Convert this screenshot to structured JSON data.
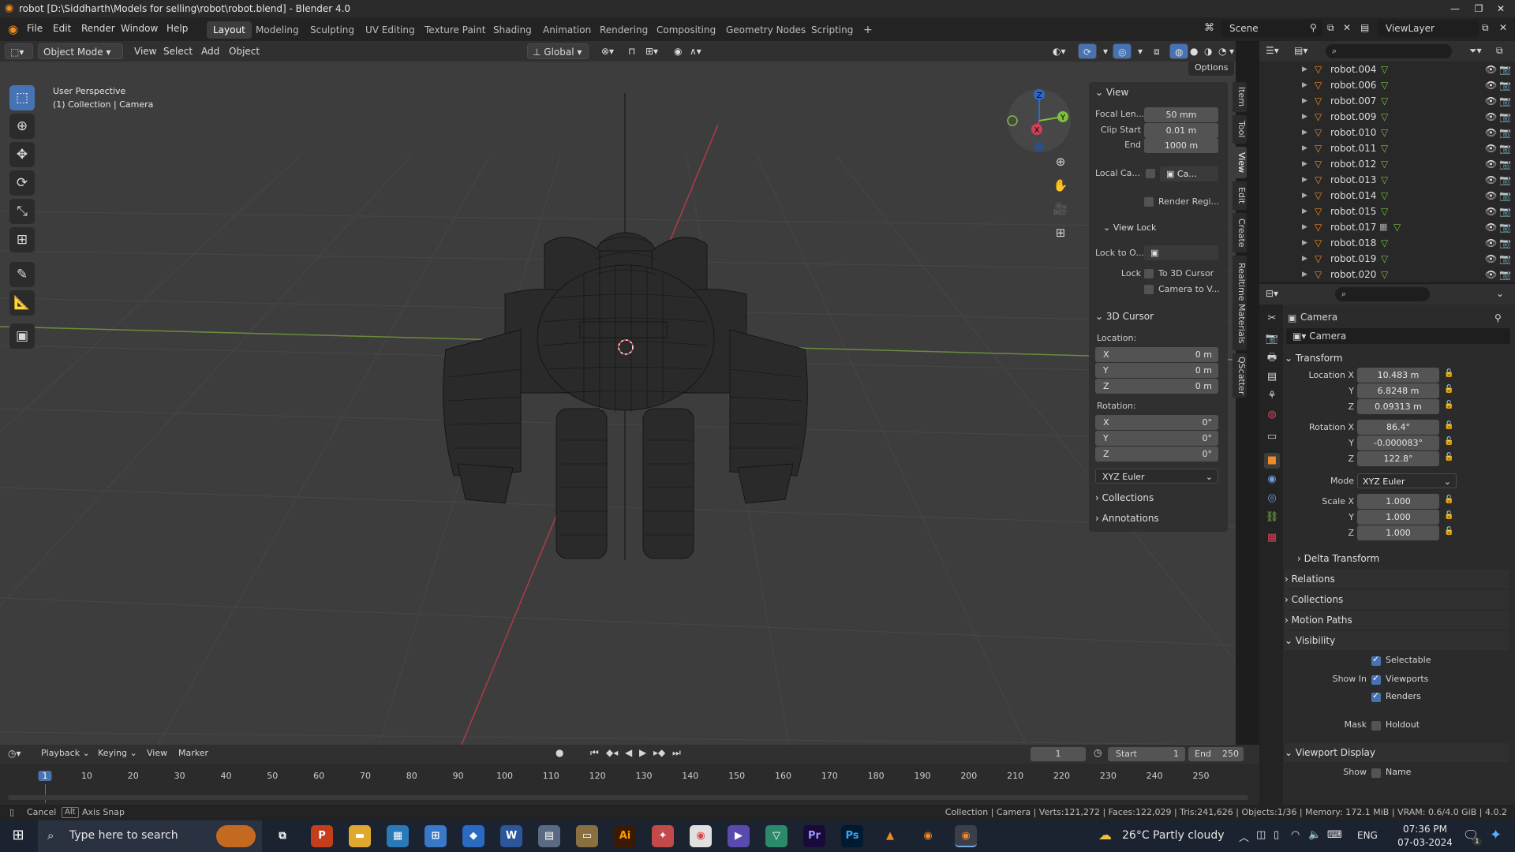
{
  "title_bar": {
    "app_title": "robot [D:\\Siddharth\\Models for selling\\robot\\robot.blend] - Blender 4.0"
  },
  "menu": [
    "File",
    "Edit",
    "Render",
    "Window",
    "Help"
  ],
  "workspaces": [
    "Layout",
    "Modeling",
    "Sculpting",
    "UV Editing",
    "Texture Paint",
    "Shading",
    "Animation",
    "Rendering",
    "Compositing",
    "Geometry Nodes",
    "Scripting"
  ],
  "active_workspace": "Layout",
  "scene": "Scene",
  "view_layer": "ViewLayer",
  "viewport_header": {
    "mode": "Object Mode",
    "menus": [
      "View",
      "Select",
      "Add",
      "Object"
    ],
    "orientation": "Global",
    "options": "Options"
  },
  "viewport": {
    "perspective_label": "User Perspective",
    "collection_label": "(1) Collection | Camera",
    "gizmo": {
      "x": "X",
      "y": "Y",
      "z": "Z"
    }
  },
  "n_panel": {
    "view_title": "View",
    "focal_label": "Focal Len...",
    "focal_value": "50 mm",
    "clip_start_label": "Clip Start",
    "clip_start_value": "0.01 m",
    "clip_end_label": "End",
    "clip_end_value": "1000 m",
    "local_cam_label": "Local Ca...",
    "local_cam_value": "Ca...",
    "render_region": "Render Regi...",
    "view_lock_title": "View Lock",
    "lock_to_label": "Lock to O...",
    "lock_label": "Lock",
    "lock_cursor": "To 3D Cursor",
    "camera_to_view": "Camera to V...",
    "cursor_title": "3D Cursor",
    "location_label": "Location:",
    "loc": [
      {
        "axis": "X",
        "value": "0 m"
      },
      {
        "axis": "Y",
        "value": "0 m"
      },
      {
        "axis": "Z",
        "value": "0 m"
      }
    ],
    "rotation_label": "Rotation:",
    "rot": [
      {
        "axis": "X",
        "value": "0°"
      },
      {
        "axis": "Y",
        "value": "0°"
      },
      {
        "axis": "Z",
        "value": "0°"
      }
    ],
    "rot_mode": "XYZ Euler",
    "collections": "Collections",
    "annotations": "Annotations"
  },
  "side_tabs": [
    "Item",
    "Tool",
    "View",
    "Edit",
    "Create",
    "Realtime Materials",
    "QScatter"
  ],
  "outliner": {
    "items": [
      {
        "name": "robot.004",
        "extra": false
      },
      {
        "name": "robot.006",
        "extra": false
      },
      {
        "name": "robot.007",
        "extra": false
      },
      {
        "name": "robot.009",
        "extra": false
      },
      {
        "name": "robot.010",
        "extra": false
      },
      {
        "name": "robot.011",
        "extra": false
      },
      {
        "name": "robot.012",
        "extra": false
      },
      {
        "name": "robot.013",
        "extra": false
      },
      {
        "name": "robot.014",
        "extra": false
      },
      {
        "name": "robot.015",
        "extra": false
      },
      {
        "name": "robot.017",
        "extra": true
      },
      {
        "name": "robot.018",
        "extra": false
      },
      {
        "name": "robot.019",
        "extra": false
      },
      {
        "name": "robot.020",
        "extra": false
      }
    ]
  },
  "properties": {
    "object_name": "Camera",
    "data_name": "Camera",
    "transform_title": "Transform",
    "location_x_label": "Location X",
    "location": [
      "10.483 m",
      "6.8248 m",
      "0.09313 m"
    ],
    "rotation_x_label": "Rotation X",
    "rotation": [
      "86.4°",
      "-0.000083°",
      "122.8°"
    ],
    "y_label": "Y",
    "z_label": "Z",
    "mode_label": "Mode",
    "mode_value": "XYZ Euler",
    "scale_x_label": "Scale X",
    "scale": [
      "1.000",
      "1.000",
      "1.000"
    ],
    "delta_transform": "Delta Transform",
    "relations": "Relations",
    "collections": "Collections",
    "motion_paths": "Motion Paths",
    "visibility": "Visibility",
    "selectable": "Selectable",
    "show_in_label": "Show In",
    "viewports": "Viewports",
    "renders": "Renders",
    "mask_label": "Mask",
    "holdout": "Holdout",
    "viewport_display": "Viewport Display",
    "show_label": "Show",
    "name_label": "Name"
  },
  "timeline": {
    "menus": [
      "Playback",
      "Keying",
      "View",
      "Marker"
    ],
    "current_frame": "1",
    "start_label": "Start",
    "start": "1",
    "end_label": "End",
    "end": "250",
    "ticks": [
      "1",
      "10",
      "20",
      "30",
      "40",
      "50",
      "60",
      "70",
      "80",
      "90",
      "100",
      "110",
      "120",
      "130",
      "140",
      "150",
      "160",
      "170",
      "180",
      "190",
      "200",
      "210",
      "220",
      "230",
      "240",
      "250"
    ]
  },
  "status_bar": {
    "cancel": "Cancel",
    "alt_key": "Alt",
    "axis_snap": "Axis Snap",
    "stats": "Collection | Camera | Verts:121,272 | Faces:122,029 | Tris:241,626 | Objects:1/36 | Memory: 172.1 MiB | VRAM: 0.6/4.0 GiB | 4.0.2"
  },
  "taskbar": {
    "search_placeholder": "Type here to search",
    "weather": "26°C  Partly cloudy",
    "language": "ENG",
    "time": "07:36 PM",
    "date": "07-03-2024",
    "notifications": "1"
  },
  "colors": {
    "accent": "#4772b3",
    "x_axis": "#d2405a",
    "y_axis": "#7fbf3f",
    "z_axis": "#2d68c9",
    "mesh": "#ff8a2a"
  }
}
